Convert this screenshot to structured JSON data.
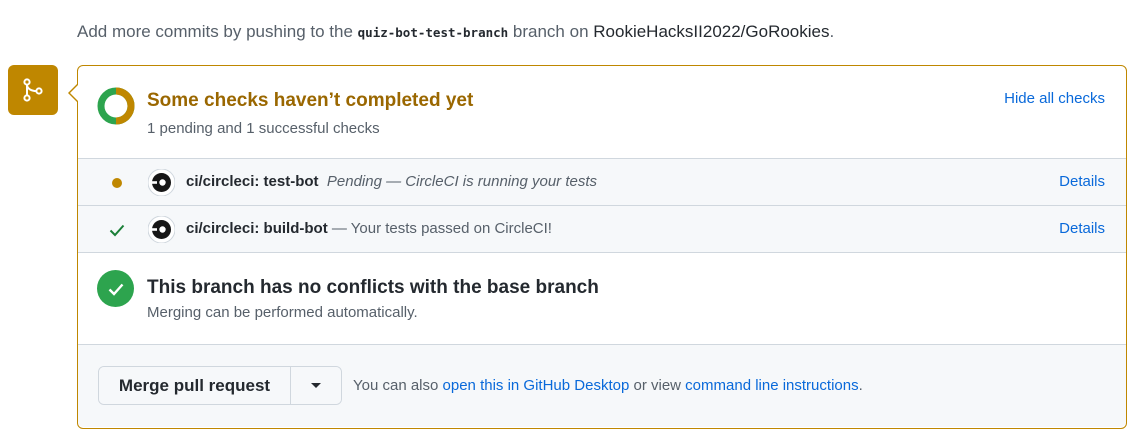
{
  "hint": {
    "prefix": "Add more commits by pushing to the",
    "branch": "quiz-bot-test-branch",
    "middle": "branch on",
    "repo": "RookieHacksII2022/GoRookies",
    "suffix": "."
  },
  "checks": {
    "title": "Some checks haven’t completed yet",
    "subtitle": "1 pending and 1 successful checks",
    "hide_label": "Hide all checks",
    "items": [
      {
        "name": "ci/circleci: test-bot",
        "status": "pending",
        "description": "Pending — CircleCI is running your tests",
        "details_label": "Details"
      },
      {
        "name": "ci/circleci: build-bot",
        "status": "success",
        "description": "— Your tests passed on CircleCI!",
        "details_label": "Details"
      }
    ]
  },
  "merge_status": {
    "title": "This branch has no conflicts with the base branch",
    "subtitle": "Merging can be performed automatically."
  },
  "actions": {
    "merge_label": "Merge pull request",
    "alt_prefix": "You can also",
    "desktop_link": "open this in GitHub Desktop",
    "alt_middle": "or view",
    "cli_link": "command line instructions",
    "alt_suffix": "."
  },
  "colors": {
    "pending": "#bf8700",
    "success": "#2da44e",
    "link": "#0969da",
    "pending_title": "#9a6700"
  },
  "icons": {
    "branch": "git-merge-icon",
    "progress": "partial-progress-ring-icon",
    "ci": "circleci-logo-icon",
    "success": "check-icon",
    "dropdown": "triangle-down-icon"
  }
}
